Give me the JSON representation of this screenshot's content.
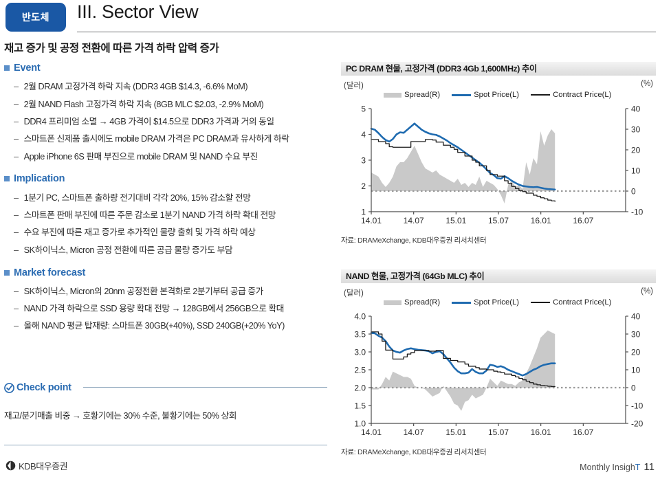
{
  "header": {
    "badge": "반도체",
    "title": "III. Sector View"
  },
  "left": {
    "headline": "재고 증가 및 공정 전환에 따른 가격 하락 압력 증가",
    "groups": [
      {
        "heading": "Event",
        "items": [
          "2월 DRAM 고정가격 하락 지속 (DDR3 4GB $14.3, -6.6% MoM)",
          "2월 NAND Flash 고정가격 하락 지속 (8GB MLC $2.03, -2.9% MoM)",
          "DDR4 프리미엄 소멸 → 4GB 가격이 $14.5으로 DDR3 가격과 거의 동일",
          "스마트폰 신제품 출시에도 mobile DRAM 가격은 PC DRAM과 유사하게 하락",
          "Apple iPhone 6S 판매 부진으로 mobile DRAM 및 NAND 수요 부진"
        ]
      },
      {
        "heading": "Implication",
        "items": [
          "1분기 PC, 스마트폰 출하량 전기대비 각각 20%, 15% 감소할 전망",
          "스마트폰 판매 부진에 따른 주문 감소로 1분기 NAND 가격 하락 확대 전망",
          "수요 부진에 따른 재고 증가로 추가적인 물량 출회 및 가격 하락 예상",
          "SK하이닉스, Micron 공정 전환에 따른 공급 물량 증가도 부담"
        ]
      },
      {
        "heading": "Market forecast",
        "items": [
          "SK하이닉스, Micron의 20nm 공정전환 본격화로 2분기부터 공급 증가",
          "NAND 가격 하락으로 SSD 용량 확대 전망 → 128GB에서 256GB으로 확대",
          "올해 NAND 평균 탑재량: 스마트폰 30GB(+40%), SSD 240GB(+20% YoY)"
        ]
      }
    ],
    "checkpoint": {
      "label": "Check point",
      "text": "재고/분기매출 비중 → 호황기에는 30% 수준, 불황기에는 50% 상회"
    }
  },
  "footer": {
    "logo": "KDB대우증권",
    "publication": "Monthly Insigh",
    "publication_accent": "T",
    "page": "11"
  },
  "chart_data": [
    {
      "id": "pc-dram",
      "type": "line",
      "title": "PC DRAM 현물, 고정가격 (DDR3 4Gb 1,600MHz) 추이",
      "ylabel": "(달러)",
      "y2label": "(%)",
      "source": "자료: DRAMeXchange, KDB대우증권 리서치센터",
      "legend": [
        "Spread(R)",
        "Spot Price(L)",
        "Contract Price(L)"
      ],
      "legend_position": "top",
      "grid": false,
      "ylim": [
        1,
        5
      ],
      "yticks": [
        "1",
        "2",
        "3",
        "4",
        "5"
      ],
      "y2lim": [
        -10,
        40
      ],
      "y2ticks": [
        "-10",
        "0",
        "10",
        "20",
        "30",
        "40"
      ],
      "xticks": [
        "14.01",
        "14.07",
        "15.01",
        "15.07",
        "16.01",
        "16.07"
      ],
      "xtick_positions": [
        0,
        6,
        12,
        18,
        24,
        30
      ],
      "xlim": [
        0,
        36
      ],
      "x_data_end": 26,
      "zero_line": 0,
      "series": [
        {
          "name": "Spot Price(L)",
          "axis": "left",
          "color": "#1f6bb0",
          "values": [
            4.22,
            4.18,
            4.05,
            3.9,
            3.78,
            3.72,
            3.82,
            4.0,
            4.08,
            4.06,
            4.18,
            4.3,
            4.42,
            4.3,
            4.18,
            4.1,
            4.04,
            4.0,
            3.98,
            3.92,
            3.84,
            3.76,
            3.66,
            3.58,
            3.5,
            3.4,
            3.3,
            3.2,
            3.1,
            3.0,
            2.9,
            2.78,
            2.64,
            2.5,
            2.42,
            2.3,
            2.28,
            2.38,
            2.3,
            2.2,
            2.12,
            2.05,
            2.0,
            1.98,
            1.96,
            1.95,
            1.96,
            1.93,
            1.9,
            1.88,
            1.87,
            1.86
          ]
        },
        {
          "name": "Contract Price(L)",
          "axis": "left",
          "color": "#1a1a1a",
          "step": true,
          "values": [
            3.8,
            3.8,
            3.72,
            3.72,
            3.64,
            3.52,
            3.5,
            3.5,
            3.5,
            3.5,
            3.5,
            3.72,
            3.72,
            3.72,
            3.72,
            3.8,
            3.8,
            3.78,
            3.7,
            3.7,
            3.58,
            3.58,
            3.5,
            3.42,
            3.3,
            3.3,
            3.16,
            3.16,
            3.0,
            2.92,
            2.78,
            2.78,
            2.6,
            2.44,
            2.44,
            2.38,
            2.38,
            2.2,
            2.1,
            1.98,
            1.9,
            1.82,
            1.78,
            1.72,
            1.72,
            1.64,
            1.6,
            1.54,
            1.5,
            1.45,
            1.42,
            1.4
          ]
        },
        {
          "name": "Spread(R)",
          "axis": "right",
          "color": "#c9c9c9",
          "type": "area",
          "values": [
            9,
            8,
            7,
            4,
            2,
            4,
            7,
            12,
            14,
            14,
            16,
            19,
            22,
            18,
            14,
            11,
            10,
            9,
            10,
            8,
            7,
            6,
            5,
            4,
            6,
            3,
            4,
            2,
            4,
            3,
            7,
            2,
            5,
            4,
            3,
            1,
            -2,
            -6,
            3,
            5,
            2,
            3,
            1,
            14,
            8,
            16,
            13,
            29,
            22,
            27,
            30,
            28
          ]
        }
      ]
    },
    {
      "id": "nand",
      "type": "line",
      "title": "NAND 현물, 고정가격 (64Gb MLC) 추이",
      "ylabel": "(달러)",
      "y2label": "(%)",
      "source": "자료: DRAMeXchange, KDB대우증권 리서치센터",
      "legend": [
        "Spread(R)",
        "Spot Price(L)",
        "Contract Price(L)"
      ],
      "legend_position": "top",
      "grid": false,
      "ylim": [
        1.0,
        4.0
      ],
      "yticks": [
        "1.0",
        "1.5",
        "2.0",
        "2.5",
        "3.0",
        "3.5",
        "4.0"
      ],
      "y2lim": [
        -20,
        40
      ],
      "y2ticks": [
        "-20",
        "-10",
        "0",
        "10",
        "20",
        "30",
        "40"
      ],
      "xticks": [
        "14.01",
        "14.07",
        "15.01",
        "15.07",
        "16.01",
        "16.07"
      ],
      "xtick_positions": [
        0,
        6,
        12,
        18,
        24,
        30
      ],
      "xlim": [
        0,
        36
      ],
      "x_data_end": 26,
      "zero_line": 0,
      "series": [
        {
          "name": "Spot Price(L)",
          "axis": "left",
          "color": "#1f6bb0",
          "values": [
            3.53,
            3.52,
            3.45,
            3.4,
            3.3,
            3.15,
            3.04,
            3.0,
            2.98,
            3.04,
            3.08,
            3.1,
            3.08,
            3.06,
            3.05,
            3.04,
            3.02,
            2.96,
            3.0,
            3.02,
            2.94,
            2.82,
            2.7,
            2.56,
            2.46,
            2.4,
            2.4,
            2.42,
            2.52,
            2.44,
            2.4,
            2.4,
            2.48,
            2.64,
            2.62,
            2.58,
            2.6,
            2.56,
            2.5,
            2.46,
            2.42,
            2.38,
            2.34,
            2.38,
            2.44,
            2.5,
            2.54,
            2.6,
            2.64,
            2.66,
            2.68,
            2.68
          ]
        },
        {
          "name": "Contract Price(L)",
          "axis": "left",
          "color": "#1a1a1a",
          "step": true,
          "values": [
            3.56,
            3.56,
            3.5,
            3.3,
            3.05,
            3.05,
            2.8,
            2.8,
            2.8,
            2.86,
            2.94,
            2.98,
            3.04,
            3.04,
            3.04,
            3.04,
            3.02,
            3.02,
            3.04,
            3.04,
            2.82,
            2.82,
            2.76,
            2.76,
            2.72,
            2.72,
            2.66,
            2.6,
            2.6,
            2.56,
            2.52,
            2.52,
            2.5,
            2.5,
            2.46,
            2.44,
            2.42,
            2.38,
            2.38,
            2.34,
            2.3,
            2.26,
            2.22,
            2.18,
            2.14,
            2.1,
            2.08,
            2.06,
            2.05,
            2.04,
            2.03,
            2.03
          ]
        },
        {
          "name": "Spread(R)",
          "axis": "right",
          "color": "#c9c9c9",
          "type": "area",
          "values": [
            -1,
            -1,
            -1,
            2,
            6,
            4,
            9,
            8,
            7,
            6,
            6,
            5,
            1,
            0,
            0,
            -1,
            -3,
            -5,
            -4,
            -3,
            1,
            -2,
            -5,
            -9,
            -10,
            -13,
            -8,
            -7,
            -4,
            -6,
            -5,
            -4,
            0,
            5,
            3,
            1,
            4,
            3,
            2,
            2,
            1,
            3,
            4,
            8,
            12,
            17,
            22,
            28,
            30,
            32,
            31,
            30
          ]
        }
      ]
    }
  ]
}
